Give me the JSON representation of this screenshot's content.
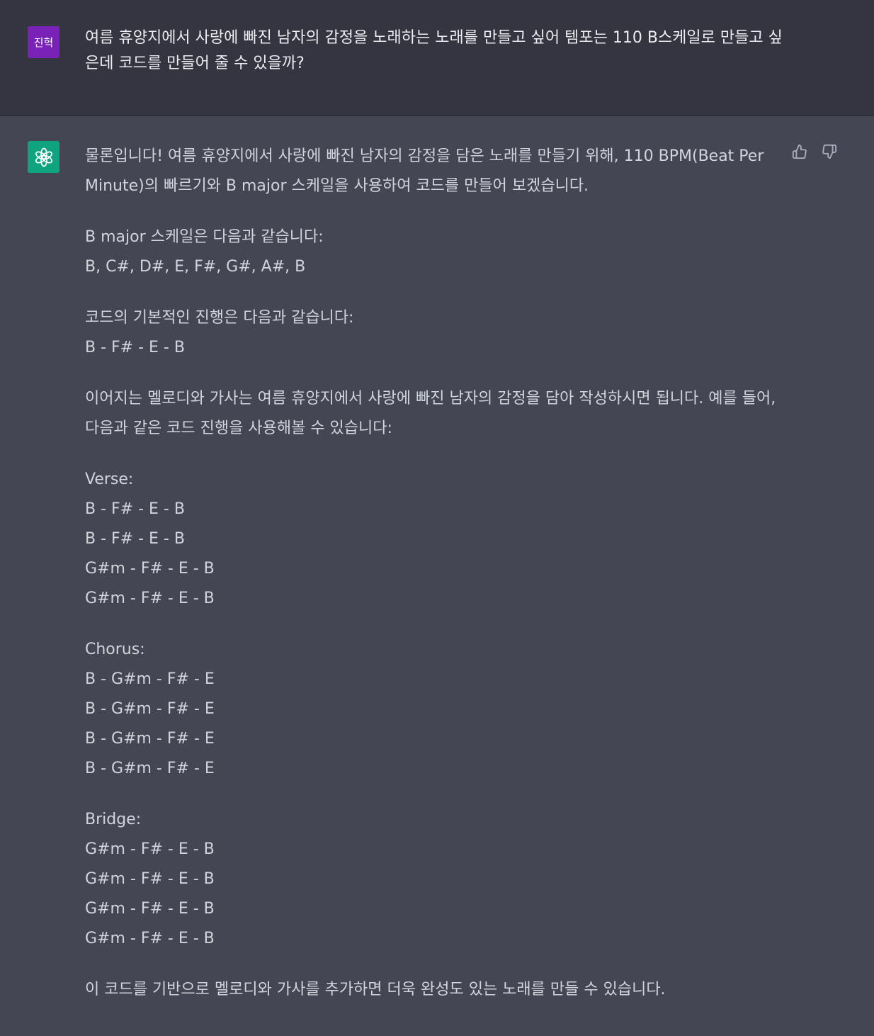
{
  "user": {
    "avatar_text": "진혁",
    "message": "여름 휴양지에서 사랑에 빠진 남자의 감정을 노래하는 노래를 만들고 싶어 템포는 110 B스케일로 만들고 싶은데 코드를 만들어 줄 수 있을까?"
  },
  "assistant": {
    "avatar_icon": "openai-logo-icon",
    "feedback": {
      "thumbs_up_icon": "thumbs-up-icon",
      "thumbs_down_icon": "thumbs-down-icon"
    },
    "intro": "물론입니다! 여름 휴양지에서 사랑에 빠진 남자의 감정을 담은 노래를 만들기 위해, 110 BPM(Beat Per Minute)의 빠르기와 B major 스케일을 사용하여 코드를 만들어 보겠습니다.",
    "scale_heading": "B major 스케일은 다음과 같습니다:",
    "scale_notes": "B, C#, D#, E, F#, G#, A#, B",
    "progression_heading": "코드의 기본적인 진행은 다음과 같습니다:",
    "progression": "B - F# - E - B",
    "melody_text": "이어지는 멜로디와 가사는 여름 휴양지에서 사랑에 빠진 남자의 감정을 담아 작성하시면 됩니다. 예를 들어, 다음과 같은 코드 진행을 사용해볼 수 있습니다:",
    "sections": [
      {
        "title": "Verse:",
        "lines": [
          "B - F# - E - B",
          "B - F# - E - B",
          "G#m - F# - E - B",
          "G#m - F# - E - B"
        ]
      },
      {
        "title": "Chorus:",
        "lines": [
          "B - G#m - F# - E",
          "B - G#m - F# - E",
          "B - G#m - F# - E",
          "B - G#m - F# - E"
        ]
      },
      {
        "title": "Bridge:",
        "lines": [
          "G#m - F# - E - B",
          "G#m - F# - E - B",
          "G#m - F# - E - B",
          "G#m - F# - E - B"
        ]
      }
    ],
    "closing": "이 코드를 기반으로 멜로디와 가사를 추가하면 더욱 완성도 있는 노래를 만들 수 있습니다."
  }
}
